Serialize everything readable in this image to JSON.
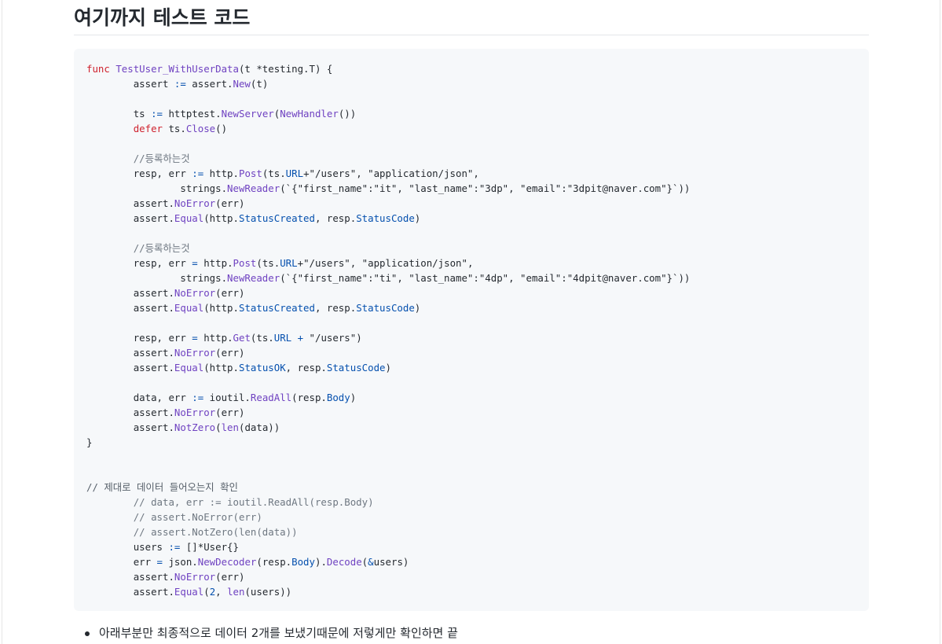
{
  "heading": "여기까지 테스트 코드",
  "code": {
    "lines": [
      {
        "seg": [
          {
            "t": "func ",
            "c": "k"
          },
          {
            "t": "TestUser_WithUserData",
            "c": "f"
          },
          {
            "t": "(t *testing.T) {",
            "c": ""
          }
        ]
      },
      {
        "seg": [
          {
            "t": "\tassert ",
            "c": ""
          },
          {
            "t": ":=",
            "c": "o"
          },
          {
            "t": " assert.",
            "c": ""
          },
          {
            "t": "New",
            "c": "fn"
          },
          {
            "t": "(t)",
            "c": ""
          }
        ]
      },
      {
        "seg": []
      },
      {
        "seg": [
          {
            "t": "\tts ",
            "c": ""
          },
          {
            "t": ":=",
            "c": "o"
          },
          {
            "t": " httptest.",
            "c": ""
          },
          {
            "t": "NewServer",
            "c": "fn"
          },
          {
            "t": "(",
            "c": ""
          },
          {
            "t": "NewHandler",
            "c": "fn"
          },
          {
            "t": "())",
            "c": ""
          }
        ]
      },
      {
        "seg": [
          {
            "t": "\t",
            "c": ""
          },
          {
            "t": "defer",
            "c": "k"
          },
          {
            "t": " ts.",
            "c": ""
          },
          {
            "t": "Close",
            "c": "fn"
          },
          {
            "t": "()",
            "c": ""
          }
        ]
      },
      {
        "seg": []
      },
      {
        "seg": [
          {
            "t": "\t//등록하는것",
            "c": "c"
          }
        ]
      },
      {
        "seg": [
          {
            "t": "\tresp, err ",
            "c": ""
          },
          {
            "t": ":=",
            "c": "o"
          },
          {
            "t": " http.",
            "c": ""
          },
          {
            "t": "Post",
            "c": "fn"
          },
          {
            "t": "(ts.",
            "c": ""
          },
          {
            "t": "URL",
            "c": "v"
          },
          {
            "t": "+\"/users\", \"application/json\",",
            "c": ""
          }
        ]
      },
      {
        "seg": [
          {
            "t": "\t\tstrings.",
            "c": ""
          },
          {
            "t": "NewReader",
            "c": "fn"
          },
          {
            "t": "(`{\"first_name\":\"it\", \"last_name\":\"3dp\", \"email\":\"3dpit@naver.com\"}`))",
            "c": ""
          }
        ]
      },
      {
        "seg": [
          {
            "t": "\tassert.",
            "c": ""
          },
          {
            "t": "NoError",
            "c": "fn"
          },
          {
            "t": "(err)",
            "c": ""
          }
        ]
      },
      {
        "seg": [
          {
            "t": "\tassert.",
            "c": ""
          },
          {
            "t": "Equal",
            "c": "fn"
          },
          {
            "t": "(http.",
            "c": ""
          },
          {
            "t": "StatusCreated",
            "c": "v"
          },
          {
            "t": ", resp.",
            "c": ""
          },
          {
            "t": "StatusCode",
            "c": "v"
          },
          {
            "t": ")",
            "c": ""
          }
        ]
      },
      {
        "seg": []
      },
      {
        "seg": [
          {
            "t": "\t//등록하는것",
            "c": "c"
          }
        ]
      },
      {
        "seg": [
          {
            "t": "\tresp, err ",
            "c": ""
          },
          {
            "t": "=",
            "c": "o"
          },
          {
            "t": " http.",
            "c": ""
          },
          {
            "t": "Post",
            "c": "fn"
          },
          {
            "t": "(ts.",
            "c": ""
          },
          {
            "t": "URL",
            "c": "v"
          },
          {
            "t": "+\"/users\", \"application/json\",",
            "c": ""
          }
        ]
      },
      {
        "seg": [
          {
            "t": "\t\tstrings.",
            "c": ""
          },
          {
            "t": "NewReader",
            "c": "fn"
          },
          {
            "t": "(`{\"first_name\":\"ti\", \"last_name\":\"4dp\", \"email\":\"4dpit@naver.com\"}`))",
            "c": ""
          }
        ]
      },
      {
        "seg": [
          {
            "t": "\tassert.",
            "c": ""
          },
          {
            "t": "NoError",
            "c": "fn"
          },
          {
            "t": "(err)",
            "c": ""
          }
        ]
      },
      {
        "seg": [
          {
            "t": "\tassert.",
            "c": ""
          },
          {
            "t": "Equal",
            "c": "fn"
          },
          {
            "t": "(http.",
            "c": ""
          },
          {
            "t": "StatusCreated",
            "c": "v"
          },
          {
            "t": ", resp.",
            "c": ""
          },
          {
            "t": "StatusCode",
            "c": "v"
          },
          {
            "t": ")",
            "c": ""
          }
        ]
      },
      {
        "seg": []
      },
      {
        "seg": [
          {
            "t": "\tresp, err ",
            "c": ""
          },
          {
            "t": "=",
            "c": "o"
          },
          {
            "t": " http.",
            "c": ""
          },
          {
            "t": "Get",
            "c": "fn"
          },
          {
            "t": "(ts.",
            "c": ""
          },
          {
            "t": "URL",
            "c": "v"
          },
          {
            "t": " ",
            "c": ""
          },
          {
            "t": "+",
            "c": "o"
          },
          {
            "t": " \"/users\")",
            "c": ""
          }
        ]
      },
      {
        "seg": [
          {
            "t": "\tassert.",
            "c": ""
          },
          {
            "t": "NoError",
            "c": "fn"
          },
          {
            "t": "(err)",
            "c": ""
          }
        ]
      },
      {
        "seg": [
          {
            "t": "\tassert.",
            "c": ""
          },
          {
            "t": "Equal",
            "c": "fn"
          },
          {
            "t": "(http.",
            "c": ""
          },
          {
            "t": "StatusOK",
            "c": "v"
          },
          {
            "t": ", resp.",
            "c": ""
          },
          {
            "t": "StatusCode",
            "c": "v"
          },
          {
            "t": ")",
            "c": ""
          }
        ]
      },
      {
        "seg": []
      },
      {
        "seg": [
          {
            "t": "\tdata, err ",
            "c": ""
          },
          {
            "t": ":=",
            "c": "o"
          },
          {
            "t": " ioutil.",
            "c": ""
          },
          {
            "t": "ReadAll",
            "c": "fn"
          },
          {
            "t": "(resp.",
            "c": ""
          },
          {
            "t": "Body",
            "c": "v"
          },
          {
            "t": ")",
            "c": ""
          }
        ]
      },
      {
        "seg": [
          {
            "t": "\tassert.",
            "c": ""
          },
          {
            "t": "NoError",
            "c": "fn"
          },
          {
            "t": "(err)",
            "c": ""
          }
        ]
      },
      {
        "seg": [
          {
            "t": "\tassert.",
            "c": ""
          },
          {
            "t": "NotZero",
            "c": "fn"
          },
          {
            "t": "(",
            "c": ""
          },
          {
            "t": "len",
            "c": "fn"
          },
          {
            "t": "(data))",
            "c": ""
          }
        ]
      },
      {
        "seg": [
          {
            "t": "}",
            "c": ""
          }
        ]
      },
      {
        "seg": []
      },
      {
        "seg": []
      },
      {
        "seg": [
          {
            "t": "// 제대로 데이터 들어오는지 확인",
            "c": "c2"
          }
        ]
      },
      {
        "seg": [
          {
            "t": "\t// data, err := ioutil.ReadAll(resp.Body)",
            "c": "c"
          }
        ]
      },
      {
        "seg": [
          {
            "t": "\t// assert.NoError(err)",
            "c": "c"
          }
        ]
      },
      {
        "seg": [
          {
            "t": "\t// assert.NotZero(len(data))",
            "c": "c"
          }
        ]
      },
      {
        "seg": [
          {
            "t": "\tusers ",
            "c": ""
          },
          {
            "t": ":=",
            "c": "o"
          },
          {
            "t": " []*User{}",
            "c": ""
          }
        ]
      },
      {
        "seg": [
          {
            "t": "\terr ",
            "c": ""
          },
          {
            "t": "=",
            "c": "o"
          },
          {
            "t": " json.",
            "c": ""
          },
          {
            "t": "NewDecoder",
            "c": "fn"
          },
          {
            "t": "(resp.",
            "c": ""
          },
          {
            "t": "Body",
            "c": "v"
          },
          {
            "t": ").",
            "c": ""
          },
          {
            "t": "Decode",
            "c": "fn"
          },
          {
            "t": "(",
            "c": ""
          },
          {
            "t": "&",
            "c": "o"
          },
          {
            "t": "users)",
            "c": ""
          }
        ]
      },
      {
        "seg": [
          {
            "t": "\tassert.",
            "c": ""
          },
          {
            "t": "NoError",
            "c": "fn"
          },
          {
            "t": "(err)",
            "c": ""
          }
        ]
      },
      {
        "seg": [
          {
            "t": "\tassert.",
            "c": ""
          },
          {
            "t": "Equal",
            "c": "fn"
          },
          {
            "t": "(",
            "c": ""
          },
          {
            "t": "2",
            "c": "v"
          },
          {
            "t": ", ",
            "c": ""
          },
          {
            "t": "len",
            "c": "fn"
          },
          {
            "t": "(users))",
            "c": ""
          }
        ]
      }
    ]
  },
  "bullets": [
    "아래부분만 최종적으로 데이터 2개를 보냈기때문에 저렇게만 확인하면 끝"
  ]
}
